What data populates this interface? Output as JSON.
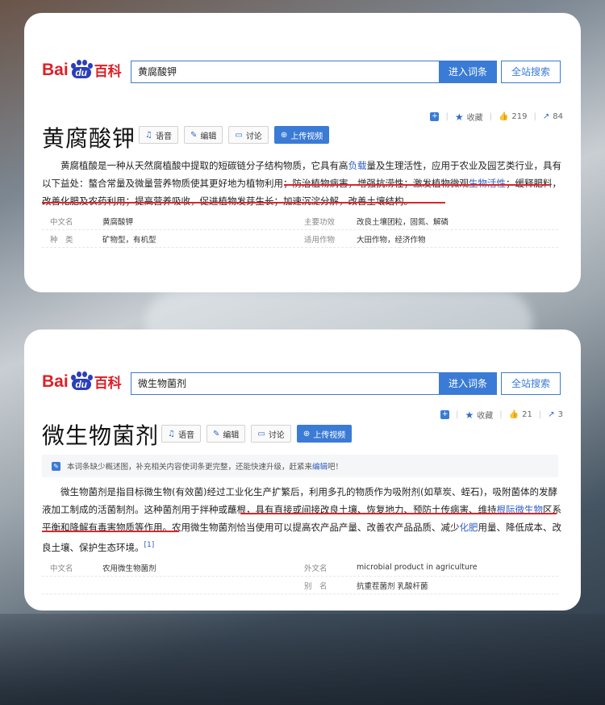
{
  "cards": [
    {
      "logo": {
        "text_bai": "Bai",
        "text_du": "du",
        "text_zh": "百科"
      },
      "search": {
        "value": "黄腐酸钾"
      },
      "buttons": {
        "enter": "进入词条",
        "site": "全站搜索"
      },
      "stats": {
        "collect": "收藏",
        "likes": "219",
        "shares": "84"
      },
      "title": "黄腐酸钾",
      "tools": {
        "voice": "语音",
        "edit": "编辑",
        "discuss": "讨论",
        "upload": "上传视频"
      },
      "paragraph": [
        "黄腐植酸是一种从天然腐植酸中提取的短碳链分子结构物质，它具有高",
        "负载",
        "量及生理活性，应用于农业及园艺类行业，具有以下益处：螯合常量及微量营养物质使其更好地为植物利用；防治植物病害，增强抗涝性；激发植物微观",
        "生物活性",
        "；缓释肥料，改善化肥及农药利用；提高营养吸收，促进植物发芽生长；加速沉淀分解，改善土壤结构。"
      ],
      "infobox": [
        {
          "k1": "中文名",
          "v1": "黄腐酸钾",
          "k2": "主要功效",
          "v2": "改良土壤团粒，固氮、解磷"
        },
        {
          "k1": "种　类",
          "v1": "矿物型，有机型",
          "k2": "适用作物",
          "v2": "大田作物，经济作物"
        }
      ]
    },
    {
      "logo": {
        "text_bai": "Bai",
        "text_du": "du",
        "text_zh": "百科"
      },
      "search": {
        "value": "微生物菌剂"
      },
      "buttons": {
        "enter": "进入词条",
        "site": "全站搜索"
      },
      "stats": {
        "collect": "收藏",
        "likes": "21",
        "shares": "3"
      },
      "title": "微生物菌剂",
      "tools": {
        "voice": "语音",
        "edit": "编辑",
        "discuss": "讨论",
        "upload": "上传视频"
      },
      "notice": {
        "text": "本词条缺少概述图，补充相关内容使词条更完整，还能快速升级，赶紧来",
        "link": "编辑",
        "tail": "吧！"
      },
      "paragraph": [
        "微生物菌剂是指目标微生物(有效菌)经过工业化生产扩繁后，利用多孔的物质作为吸附剂(如草炭、蛭石)，吸附菌体的发酵液加工制成的活菌制剂。这种菌剂用于拌种或蘸根，具有直接或间接改良土壤、恢复地力、预防土传病害、维持",
        "根际微生物",
        "区系平衡和降解有毒害物质等作用。农用微生物菌剂恰当使用可以提高农产品产量、改善农产品品质、减少",
        "化肥",
        "用量、降低成本、改良土壤、保护生态环境。",
        "[1]"
      ],
      "infobox": [
        {
          "k1": "中文名",
          "v1": "农用微生物菌剂",
          "k2": "外文名",
          "v2": "microbial product in agriculture"
        },
        {
          "k1": "",
          "v1": "",
          "k2": "别　名",
          "v2": "抗重茬菌剂 乳酸杆菌"
        }
      ]
    }
  ]
}
